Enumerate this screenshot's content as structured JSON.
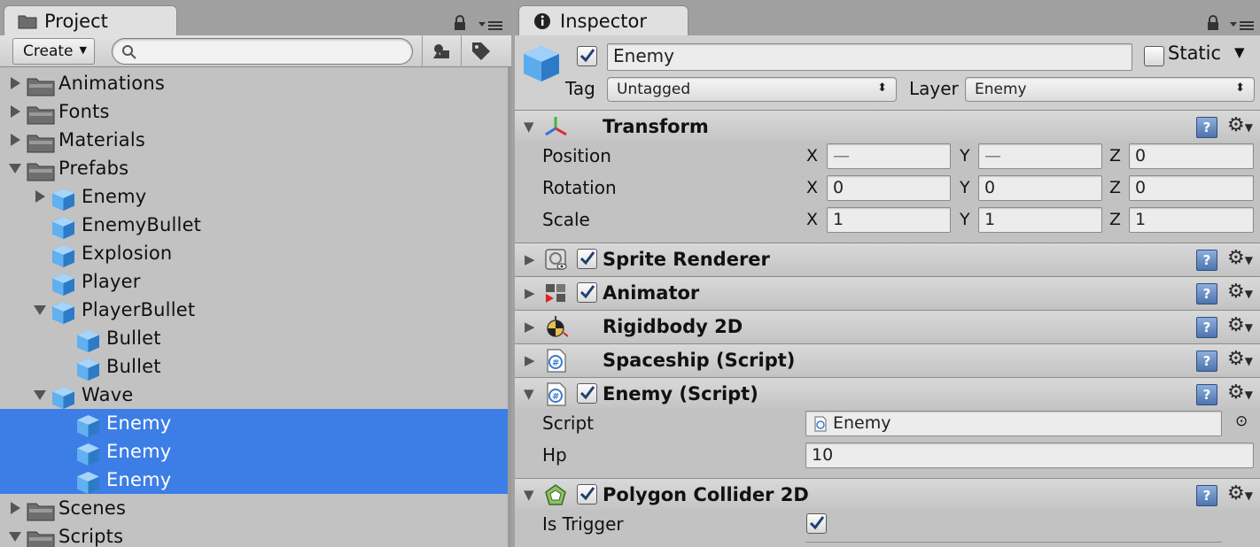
{
  "project": {
    "tab_label": "Project",
    "create_label": "Create",
    "search_placeholder": "",
    "tree": [
      {
        "label": "Animations",
        "type": "folder",
        "depth": 0,
        "arrow": "right",
        "selected": false
      },
      {
        "label": "Fonts",
        "type": "folder",
        "depth": 0,
        "arrow": "right",
        "selected": false
      },
      {
        "label": "Materials",
        "type": "folder",
        "depth": 0,
        "arrow": "right",
        "selected": false
      },
      {
        "label": "Prefabs",
        "type": "folder",
        "depth": 0,
        "arrow": "down",
        "selected": false
      },
      {
        "label": "Enemy",
        "type": "prefab",
        "depth": 1,
        "arrow": "right",
        "selected": false
      },
      {
        "label": "EnemyBullet",
        "type": "prefab",
        "depth": 1,
        "arrow": "none",
        "selected": false
      },
      {
        "label": "Explosion",
        "type": "prefab",
        "depth": 1,
        "arrow": "none",
        "selected": false
      },
      {
        "label": "Player",
        "type": "prefab",
        "depth": 1,
        "arrow": "none",
        "selected": false
      },
      {
        "label": "PlayerBullet",
        "type": "prefab",
        "depth": 1,
        "arrow": "down",
        "selected": false
      },
      {
        "label": "Bullet",
        "type": "prefab",
        "depth": 2,
        "arrow": "none",
        "selected": false
      },
      {
        "label": "Bullet",
        "type": "prefab",
        "depth": 2,
        "arrow": "none",
        "selected": false
      },
      {
        "label": "Wave",
        "type": "prefab",
        "depth": 1,
        "arrow": "down",
        "selected": false
      },
      {
        "label": "Enemy",
        "type": "prefab",
        "depth": 2,
        "arrow": "none",
        "selected": true
      },
      {
        "label": "Enemy",
        "type": "prefab",
        "depth": 2,
        "arrow": "none",
        "selected": true
      },
      {
        "label": "Enemy",
        "type": "prefab",
        "depth": 2,
        "arrow": "none",
        "selected": true
      },
      {
        "label": "Scenes",
        "type": "folder",
        "depth": 0,
        "arrow": "right",
        "selected": false
      },
      {
        "label": "Scripts",
        "type": "folder",
        "depth": 0,
        "arrow": "down",
        "selected": false
      }
    ]
  },
  "inspector": {
    "tab_label": "Inspector",
    "object_name": "Enemy",
    "active": true,
    "static_label": "Static",
    "static_checked": false,
    "tag_label": "Tag",
    "tag_value": "Untagged",
    "layer_label": "Layer",
    "layer_value": "Enemy",
    "transform": {
      "title": "Transform",
      "position_label": "Position",
      "rotation_label": "Rotation",
      "scale_label": "Scale",
      "axis_x": "X",
      "axis_y": "Y",
      "axis_z": "Z",
      "position": {
        "x": "—",
        "y": "—",
        "z": "0"
      },
      "rotation": {
        "x": "0",
        "y": "0",
        "z": "0"
      },
      "scale": {
        "x": "1",
        "y": "1",
        "z": "1"
      }
    },
    "components": {
      "sprite_renderer": "Sprite Renderer",
      "animator": "Animator",
      "rigidbody": "Rigidbody 2D",
      "spaceship": "Spaceship (Script)",
      "enemy": "Enemy (Script)",
      "polygon": "Polygon Collider 2D"
    },
    "enemy_script": {
      "script_label": "Script",
      "script_value": "Enemy",
      "hp_label": "Hp",
      "hp_value": "10"
    },
    "polygon": {
      "is_trigger_label": "Is Trigger",
      "is_trigger": true
    }
  },
  "colors": {
    "selection": "#3c7ee6",
    "panel": "#c2c2c2",
    "cube": "#4a9fe0"
  }
}
